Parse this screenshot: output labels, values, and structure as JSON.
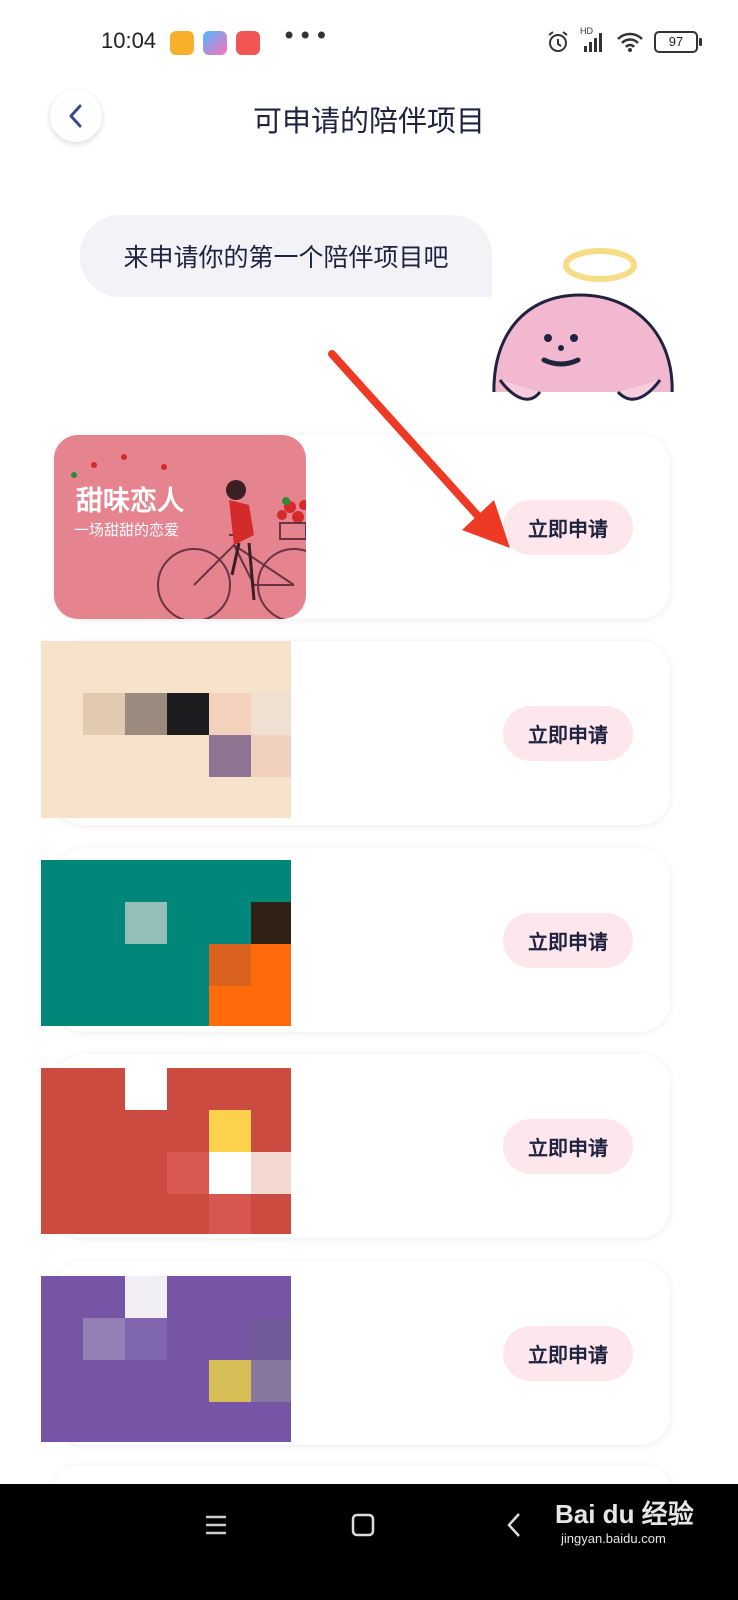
{
  "status_bar": {
    "time": "10:04",
    "dots": "•••",
    "network": "HD",
    "battery": "97"
  },
  "header": {
    "back_icon": "chevron-left-icon",
    "title": "可申请的陪伴项目"
  },
  "bubble": {
    "text": "来申请你的第一个陪伴项目吧"
  },
  "featured": {
    "title": "甜味恋人",
    "subtitle": "一场甜甜的恋爱"
  },
  "cards": [
    {
      "button": "立即申请"
    },
    {
      "button": "立即申请"
    },
    {
      "button": "立即申请"
    },
    {
      "button": "立即申请"
    },
    {
      "button": "立即申请"
    }
  ],
  "watermark": {
    "brand": "Bai du 经验",
    "url": "jingyan.baidu.com"
  },
  "colors": {
    "title": "#1f2340",
    "button_bg": "#fde7ec",
    "featured_bg": "#e5838f",
    "annotation_arrow": "#ee3a24"
  }
}
